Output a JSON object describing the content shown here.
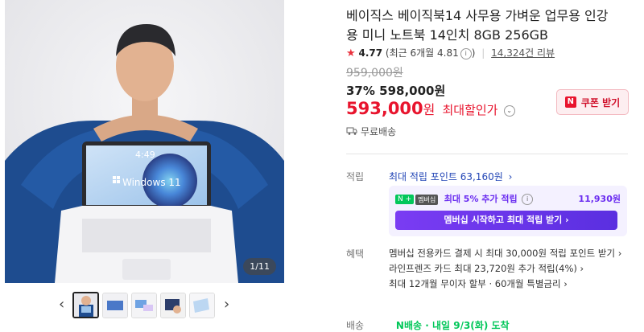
{
  "gallery": {
    "counter": "1/11",
    "screen_time": "4:49",
    "screen_os": "Windows 11",
    "thumbnails": [
      "thumb-1",
      "thumb-2",
      "thumb-3",
      "thumb-4",
      "thumb-5",
      "thumb-6"
    ],
    "prev_icon": "‹",
    "next_icon": "›"
  },
  "product": {
    "title": "베이직스 베이직북14 사무용 가벼운 업무용 인강용 미니 노트북 14인치 8GB 256GB",
    "rating": "4.77",
    "rating_recent": "(최근 6개월 4.81",
    "rating_recent_close": ")",
    "reviews": "14,324건 리뷰",
    "original_price": "959,000원",
    "discount_rate": "37%",
    "discount_price": "598,000원",
    "max_price": "593,000",
    "max_unit": "원",
    "max_label": "최대할인가",
    "coupon_label": "쿠폰 받기",
    "coupon_logo": "N",
    "delivery": "무료배송"
  },
  "points": {
    "label": "적립",
    "max_point": "최대 적립 포인트 63,160원",
    "member_badge_n": "N + ",
    "member_badge_m": "멤버십",
    "member_text": "최대 5% 추가 적립",
    "member_amount": "11,930원",
    "member_button": "멤버십 시작하고 최대 적립 받기 ›"
  },
  "benefits": {
    "label": "혜택",
    "items": [
      "멤버십 전용카드 결제 시 최대 30,000원 적립 포인트 받기 ›",
      "라인프렌즈 카드 최대 23,720원 추가 적립(4%) ›",
      "최대 12개월 무이자 할부 · 60개월 특별금리 ›"
    ]
  },
  "shipping": {
    "label": "배송",
    "text": "N배송 · 내일 9/3(화) 도착"
  },
  "colors": {
    "accent_red": "#e8142d",
    "member_purple": "#6a2cf0",
    "link_blue": "#2346b6"
  }
}
